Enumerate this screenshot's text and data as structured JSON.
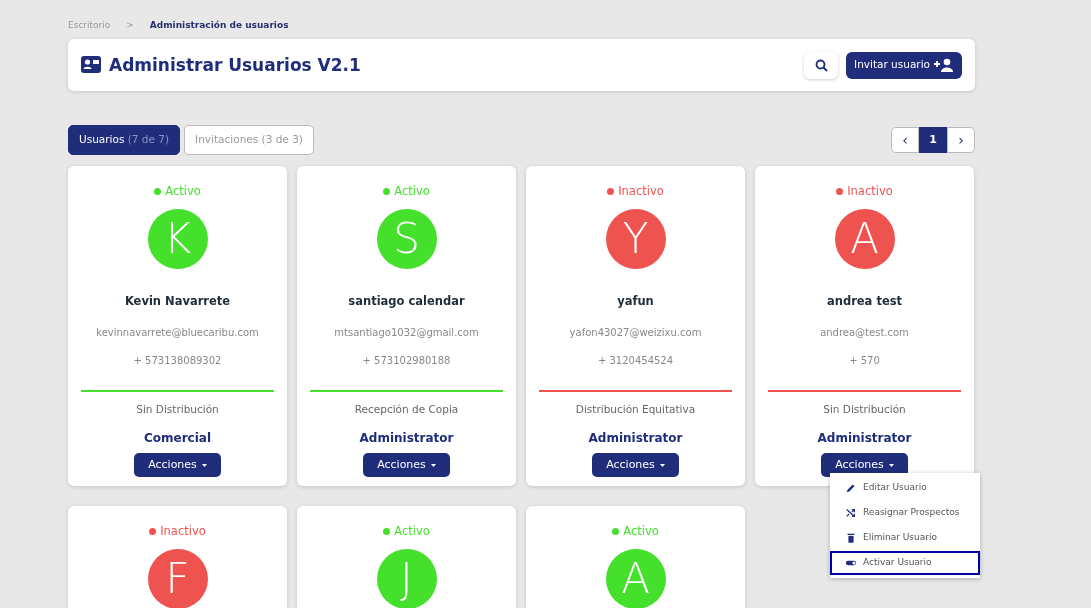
{
  "breadcrumb": [
    {
      "label": "Escritorio",
      "current": false
    },
    {
      "label": "Administración de usuarios",
      "current": true
    }
  ],
  "breadcrumb_separator": ">",
  "header": {
    "title": "Administrar Usuarios V2.1",
    "invite_button": "Invitar usuario"
  },
  "tabs": [
    {
      "label": "Usuarios",
      "count": "(7 de 7)",
      "selected": true
    },
    {
      "label": "Invitaciones",
      "count": "(3 de 3)",
      "selected": false
    }
  ],
  "pagination": {
    "prev": "‹",
    "pages": [
      {
        "label": "1",
        "selected": true
      }
    ],
    "next": "›"
  },
  "users": [
    {
      "status": "Activo",
      "active": true,
      "initial": "K",
      "name": "Kevin Navarrete",
      "email": "kevinnavarrete@bluecaribu.com",
      "phone": "+ 573138089302",
      "distribution": "Sin Distribución",
      "role": "Comercial",
      "actions": "Acciones",
      "menu_open": false
    },
    {
      "status": "Activo",
      "active": true,
      "initial": "S",
      "name": "santiago calendar",
      "email": "mtsantiago1032@gmail.com",
      "phone": "+ 573102980188",
      "distribution": "Recepción de Copia",
      "role": "Administrator",
      "actions": "Acciones",
      "menu_open": false
    },
    {
      "status": "Inactivo",
      "active": false,
      "initial": "Y",
      "name": "yafun",
      "email": "yafon43027@weizixu.com",
      "phone": "+ 3120454524",
      "distribution": "Distribución Equitativa",
      "role": "Administrator",
      "actions": "Acciones",
      "menu_open": false
    },
    {
      "status": "Inactivo",
      "active": false,
      "initial": "A",
      "name": "andrea test",
      "email": "andrea@test.com",
      "phone": "+ 570",
      "distribution": "Sin Distribución",
      "role": "Administrator",
      "actions": "Acciones",
      "menu_open": true
    },
    {
      "status": "Inactivo",
      "active": false,
      "initial": "F"
    },
    {
      "status": "Activo",
      "active": true,
      "initial": "J"
    },
    {
      "status": "Activo",
      "active": true,
      "initial": "A"
    }
  ],
  "actions_menu": [
    {
      "label": "Editar Usuario",
      "kind": "edit",
      "selected": false
    },
    {
      "label": "Reasignar Prospectos",
      "kind": "shuffle",
      "selected": false
    },
    {
      "label": "Eliminar Usuario",
      "kind": "delete",
      "selected": false
    },
    {
      "label": "Activar Usuario",
      "kind": "toggle",
      "selected": true
    }
  ]
}
